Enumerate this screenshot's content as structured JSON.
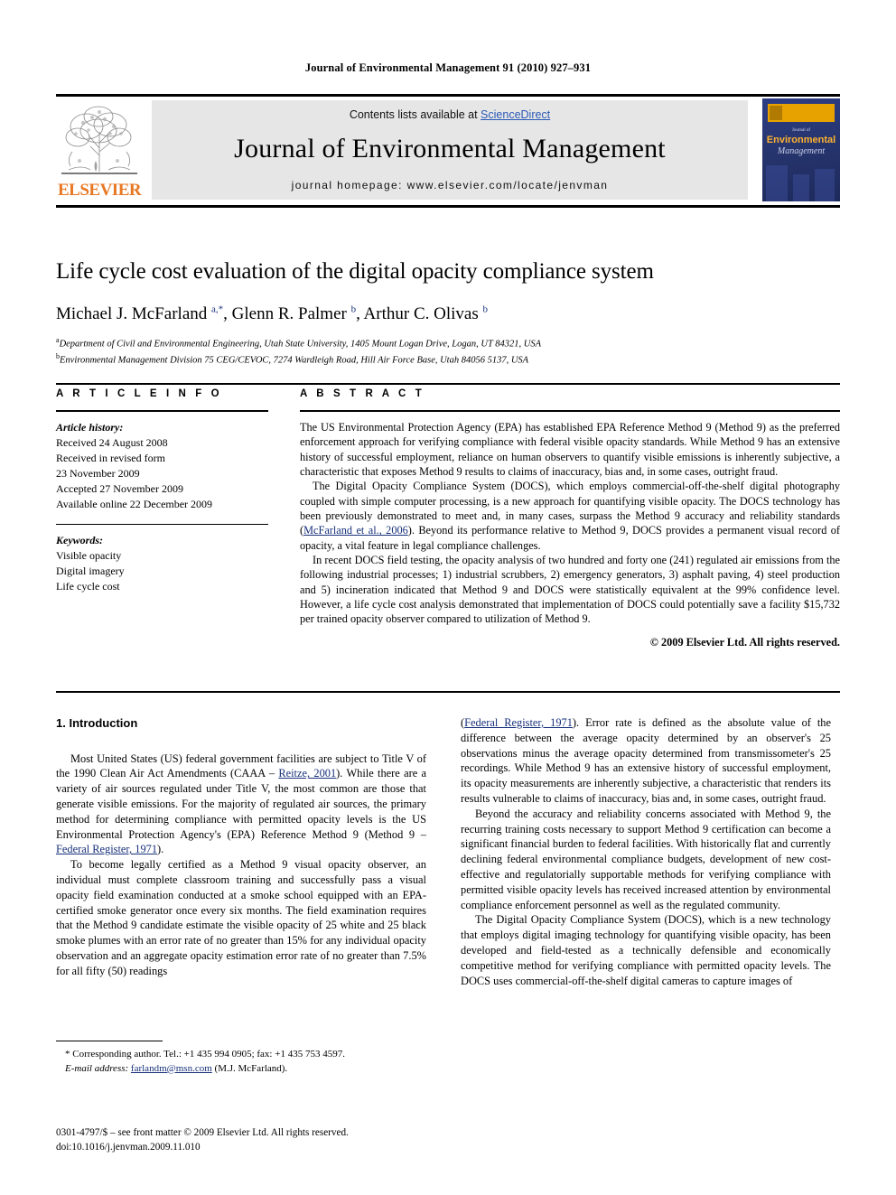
{
  "running_head": "Journal of Environmental Management 91 (2010) 927–931",
  "masthead": {
    "publisher": "ELSEVIER",
    "contents_prefix": "Contents lists available at ",
    "contents_link": "ScienceDirect",
    "journal_title": "Journal of Environmental Management",
    "homepage": "journal homepage: www.elsevier.com/locate/jenvman",
    "cover": {
      "small_title": "Journal of",
      "line1": "Environmental",
      "line2": "Management"
    }
  },
  "article": {
    "title": "Life cycle cost evaluation of the digital opacity compliance system",
    "authors_html": "Michael J. McFarland <sup>a,*</sup>, Glenn R. Palmer <sup>b</sup>, Arthur C. Olivas <sup>b</sup>",
    "affiliation_a": "Department of Civil and Environmental Engineering, Utah State University, 1405 Mount Logan Drive, Logan, UT 84321, USA",
    "affiliation_b": "Environmental Management Division 75 CEG/CEVOC, 7274 Wardleigh Road, Hill Air Force Base, Utah 84056 5137, USA"
  },
  "info": {
    "heading": "A R T I C L E   I N F O",
    "history_label": "Article history:",
    "history": [
      "Received 24 August 2008",
      "Received in revised form",
      "23 November 2009",
      "Accepted 27 November 2009",
      "Available online 22 December 2009"
    ],
    "keywords_label": "Keywords:",
    "keywords": [
      "Visible opacity",
      "Digital imagery",
      "Life cycle cost"
    ]
  },
  "abstract": {
    "heading": "A B S T R A C T",
    "paragraph1": "The US Environmental Protection Agency (EPA) has established EPA Reference Method 9 (Method 9) as the preferred enforcement approach for verifying compliance with federal visible opacity standards. While Method 9 has an extensive history of successful employment, reliance on human observers to quantify visible emissions is inherently subjective, a characteristic that exposes Method 9 results to claims of inaccuracy, bias and, in some cases, outright fraud.",
    "paragraph2_pre": "The Digital Opacity Compliance System (DOCS), which employs commercial-off-the-shelf digital photography coupled with simple computer processing, is a new approach for quantifying visible opacity. The DOCS technology has been previously demonstrated to meet and, in many cases, surpass the Method 9 accuracy and reliability standards (",
    "paragraph2_link": "McFarland et al., 2006",
    "paragraph2_post": "). Beyond its performance relative to Method 9, DOCS provides a permanent visual record of opacity, a vital feature in legal compliance challenges.",
    "paragraph3": "In recent DOCS field testing, the opacity analysis of two hundred and forty one (241) regulated air emissions from the following industrial processes; 1) industrial scrubbers, 2) emergency generators, 3) asphalt paving, 4) steel production and 5) incineration indicated that Method 9 and DOCS were statistically equivalent at the 99% confidence level. However, a life cycle cost analysis demonstrated that implementation of DOCS could potentially save a facility $15,732 per trained opacity observer compared to utilization of Method 9.",
    "copyright": "© 2009 Elsevier Ltd. All rights reserved."
  },
  "body": {
    "section1_heading": "1. Introduction",
    "left": {
      "p1_pre": "Most United States (US) federal government facilities are subject to Title V of the 1990 Clean Air Act Amendments (CAAA – ",
      "p1_link": "Reitze, 2001",
      "p1_mid": "). While there are a variety of air sources regulated under Title V, the most common are those that generate visible emissions. For the majority of regulated air sources, the primary method for determining compliance with permitted opacity levels is the US Environmental Protection Agency's (EPA) Reference Method 9 (Method 9 – ",
      "p1_link2": "Federal Register, 1971",
      "p1_post": ").",
      "p2": "To become legally certified as a Method 9 visual opacity observer, an individual must complete classroom training and successfully pass a visual opacity field examination conducted at a smoke school equipped with an EPA-certified smoke generator once every six months. The field examination requires that the Method 9 candidate estimate the visible opacity of 25 white and 25 black smoke plumes with an error rate of no greater than 15% for any individual opacity observation and an aggregate opacity estimation error rate of no greater than 7.5% for all fifty (50) readings"
    },
    "right": {
      "p1_link": "Federal Register, 1971",
      "p1_post": "). Error rate is defined as the absolute value of the difference between the average opacity determined by an observer's 25 observations minus the average opacity determined from transmissometer's 25 recordings. While Method 9 has an extensive history of successful employment, its opacity measurements are inherently subjective, a characteristic that renders its results vulnerable to claims of inaccuracy, bias and, in some cases, outright fraud.",
      "p2": "Beyond the accuracy and reliability concerns associated with Method 9, the recurring training costs necessary to support Method 9 certification can become a significant financial burden to federal facilities. With historically flat and currently declining federal environmental compliance budgets, development of new cost-effective and regulatorially supportable methods for verifying compliance with permitted visible opacity levels has received increased attention by environmental compliance enforcement personnel as well as the regulated community.",
      "p3": "The Digital Opacity Compliance System (DOCS), which is a new technology that employs digital imaging technology for quantifying visible opacity, has been developed and field-tested as a technically defensible and economically competitive method for verifying compliance with permitted opacity levels. The DOCS uses commercial-off-the-shelf digital cameras to capture images of"
    }
  },
  "footnote": {
    "corresponding": "* Corresponding author. Tel.: +1 435 994 0905; fax: +1 435 753 4597.",
    "email_label": "E-mail address:",
    "email": "farlandm@msn.com",
    "email_suffix": "(M.J. McFarland)."
  },
  "imprint": {
    "line1": "0301-4797/$ – see front matter © 2009 Elsevier Ltd. All rights reserved.",
    "line2": "doi:10.1016/j.jenvman.2009.11.010"
  },
  "colors": {
    "link": "#17307a",
    "sciencedirect": "#2b59b5",
    "elsevier_orange": "#E87722"
  }
}
